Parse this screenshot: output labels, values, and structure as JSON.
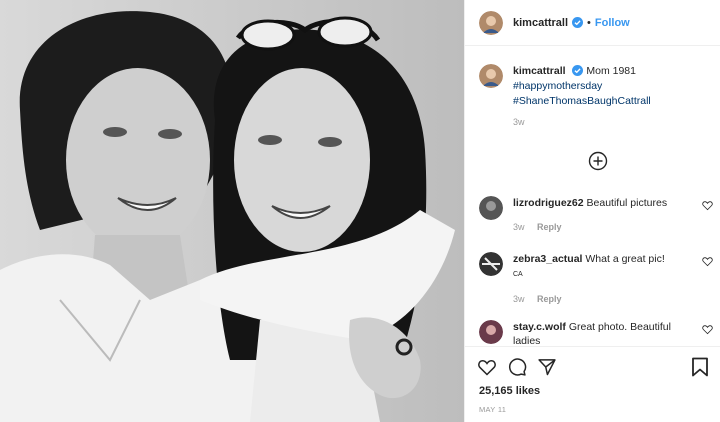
{
  "header": {
    "username": "kimcattrall",
    "separator": "•",
    "follow_label": "Follow"
  },
  "caption": {
    "username": "kimcattrall",
    "text": "Mom 1981",
    "hashtags": [
      "#happymothersday",
      "#ShaneThomasBaughCattrall"
    ],
    "age": "3w"
  },
  "comments": [
    {
      "username": "lizrodriguez62",
      "text": "Beautiful pictures",
      "age": "3w",
      "reply_label": "Reply",
      "extra": ""
    },
    {
      "username": "zebra3_actual",
      "text": "What a great pic!",
      "age": "3w",
      "reply_label": "Reply",
      "extra": "CA"
    },
    {
      "username": "stay.c.wolf",
      "text": "Great photo. Beautiful ladies",
      "age": "",
      "reply_label": "",
      "extra": ""
    }
  ],
  "stats": {
    "likes": "25,165 likes",
    "date": "MAY 11"
  },
  "colors": {
    "link": "#3897f0",
    "hashtag": "#003569",
    "muted": "#999999"
  },
  "icons": [
    "verified-badge-icon",
    "add-comment-icon",
    "heart-icon",
    "comment-icon",
    "share-icon",
    "bookmark-icon"
  ]
}
